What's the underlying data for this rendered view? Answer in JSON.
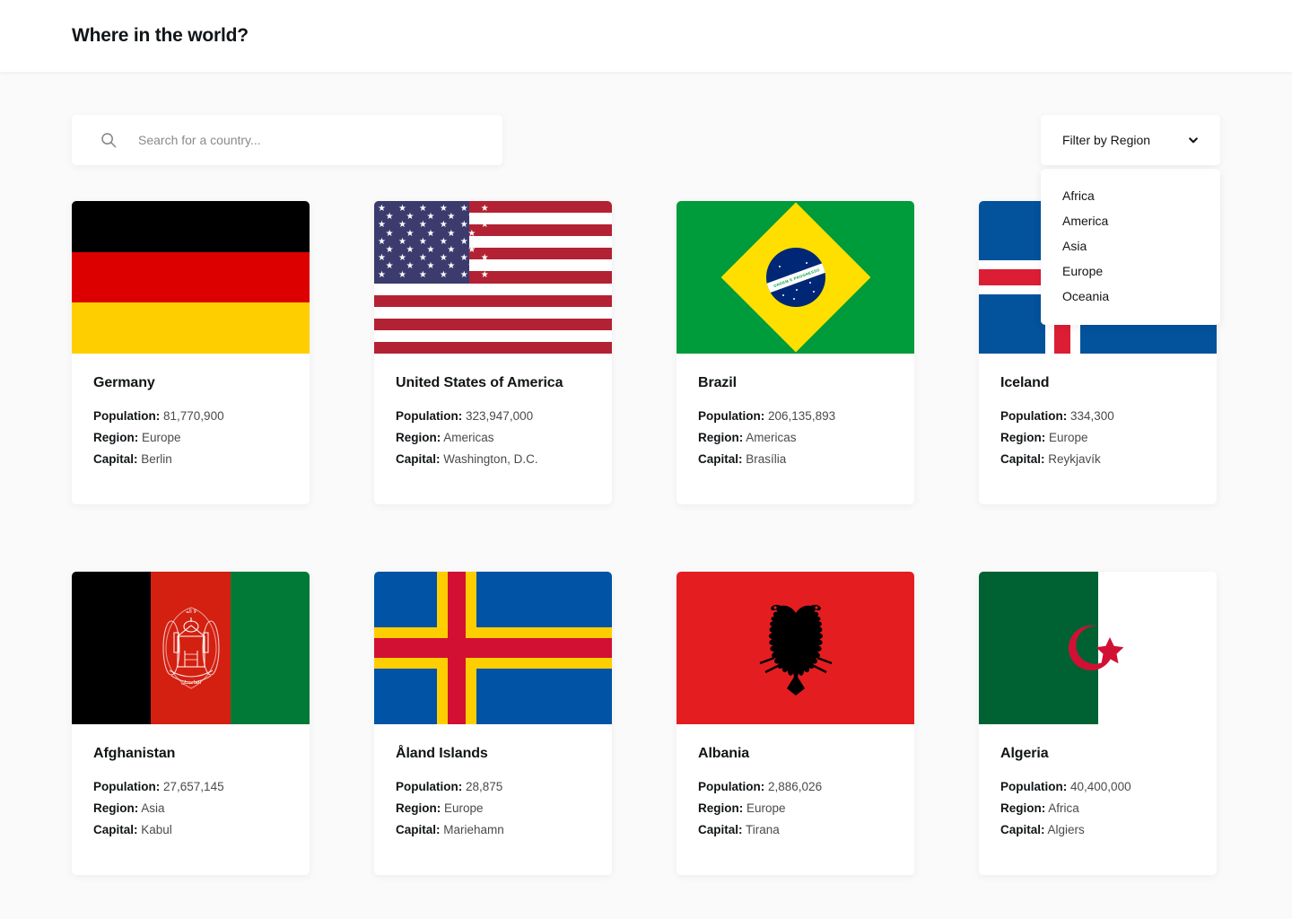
{
  "header": {
    "title": "Where in the world?"
  },
  "search": {
    "placeholder": "Search for a country...",
    "value": "",
    "icon": "search-icon"
  },
  "filter": {
    "label": "Filter by Region",
    "icon": "chevron-down-icon",
    "expanded": true,
    "options": [
      "Africa",
      "America",
      "Asia",
      "Europe",
      "Oceania"
    ]
  },
  "labels": {
    "population": "Population:",
    "region": "Region:",
    "capital": "Capital:"
  },
  "countries": [
    {
      "name": "Germany",
      "population": "81,770,900",
      "region": "Europe",
      "capital": "Berlin",
      "flag": "germany-flag"
    },
    {
      "name": "United States of America",
      "population": "323,947,000",
      "region": "Americas",
      "capital": "Washington, D.C.",
      "flag": "united-states-flag"
    },
    {
      "name": "Brazil",
      "population": "206,135,893",
      "region": "Americas",
      "capital": "Brasília",
      "flag": "brazil-flag",
      "flag_motto": "ORDEM E PROGRESSO"
    },
    {
      "name": "Iceland",
      "population": "334,300",
      "region": "Europe",
      "capital": "Reykjavík",
      "flag": "iceland-flag"
    },
    {
      "name": "Afghanistan",
      "population": "27,657,145",
      "region": "Asia",
      "capital": "Kabul",
      "flag": "afghanistan-flag"
    },
    {
      "name": "Åland Islands",
      "population": "28,875",
      "region": "Europe",
      "capital": "Mariehamn",
      "flag": "aland-islands-flag"
    },
    {
      "name": "Albania",
      "population": "2,886,026",
      "region": "Europe",
      "capital": "Tirana",
      "flag": "albania-flag"
    },
    {
      "name": "Algeria",
      "population": "40,400,000",
      "region": "Africa",
      "capital": "Algiers",
      "flag": "algeria-flag"
    }
  ],
  "colors": {
    "page_background": "#fafafa",
    "surface": "#ffffff",
    "text": "#111517",
    "muted_text": "#4a4a4a",
    "placeholder": "#8a8a8a"
  }
}
